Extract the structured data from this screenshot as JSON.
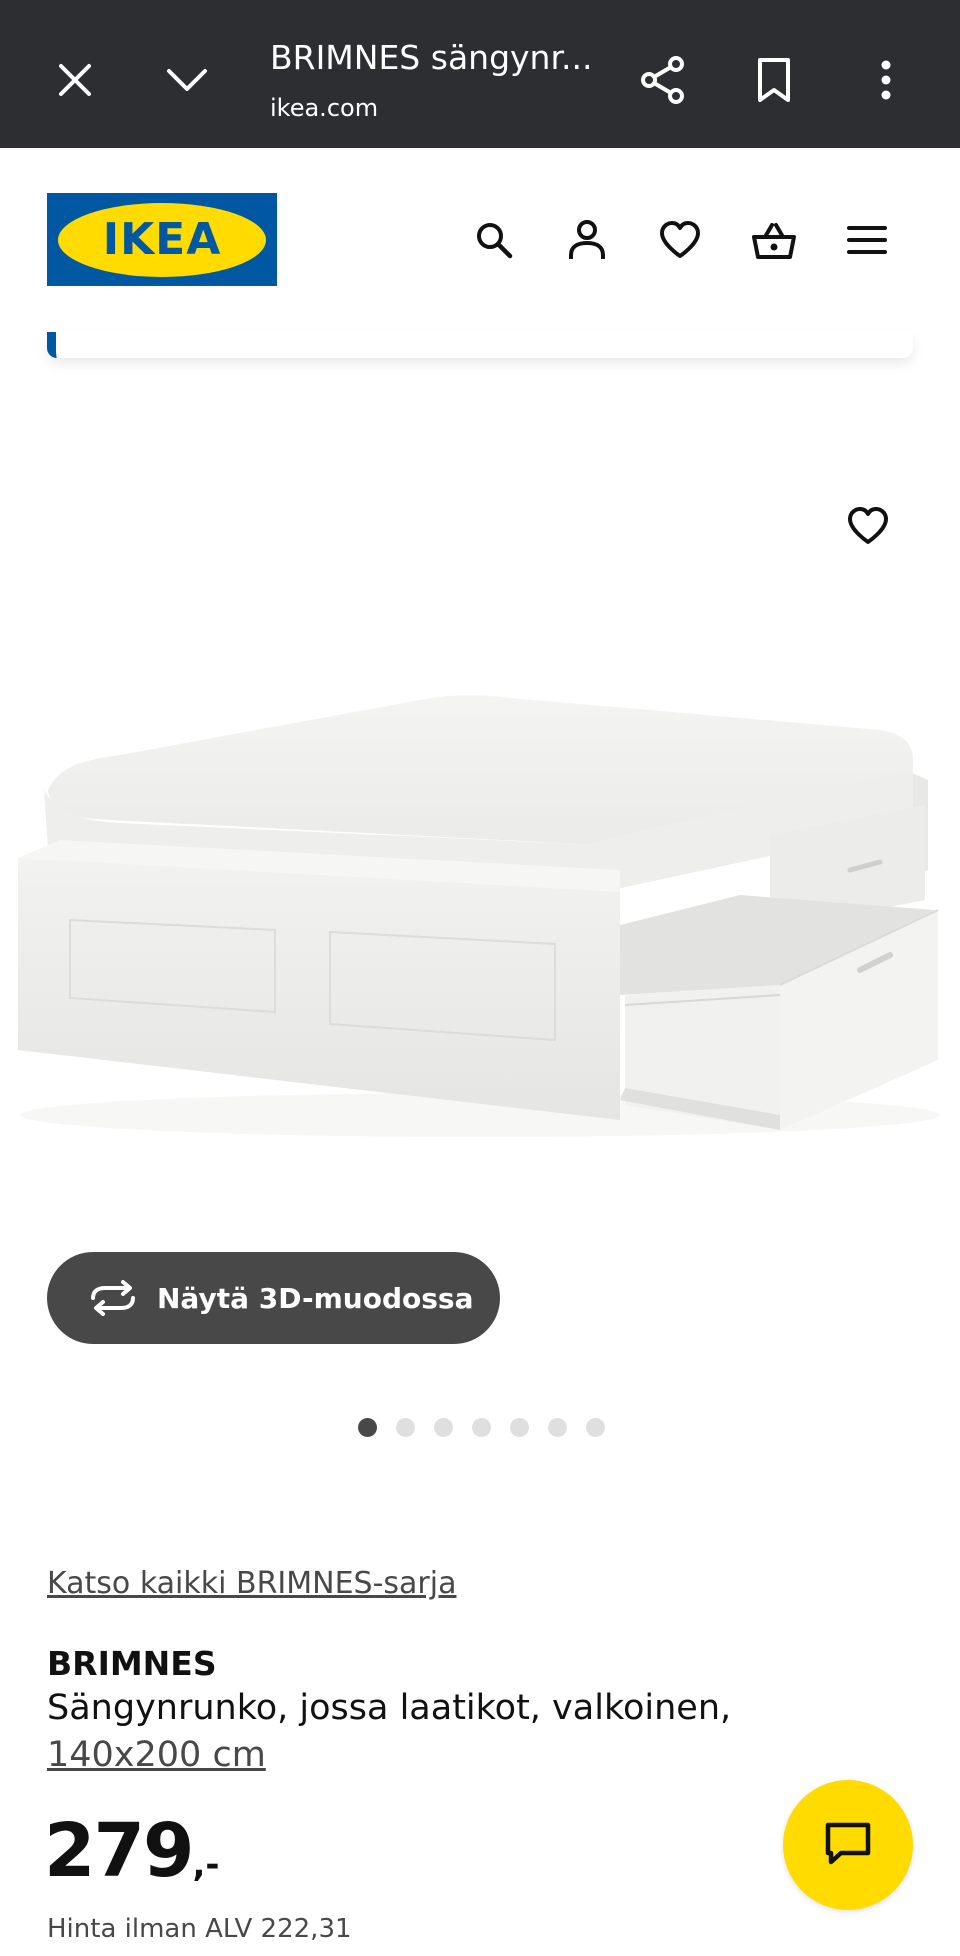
{
  "browser": {
    "title": "BRIMNES sängynr...",
    "url": "ikea.com",
    "icons": [
      "close-icon",
      "chevron-down-icon",
      "share-icon",
      "bookmark-icon",
      "more-vert-icon"
    ]
  },
  "header": {
    "logo_text": "IKEA",
    "logo_colors": {
      "blue": "#0058a3",
      "yellow": "#ffdb00"
    },
    "icons": [
      "search-icon",
      "user-icon",
      "heart-icon",
      "basket-icon",
      "menu-icon"
    ]
  },
  "media": {
    "view_3d_label": "Näytä 3D-muodossa",
    "image_count": 7,
    "active_image": 1
  },
  "product": {
    "series_link": "Katso kaikki BRIMNES-sarja",
    "name": "BRIMNES",
    "description": "Sängynrunko, jossa laatikot, valkoinen,",
    "size": "140x200 cm",
    "price_main": "279",
    "price_suffix": ",-",
    "price_ex_vat": "Hinta ilman ALV 222,31"
  },
  "colors": {
    "browser_bar": "#2d2e31",
    "button_dark": "#484848",
    "chat_yellow": "#ffdb00"
  }
}
